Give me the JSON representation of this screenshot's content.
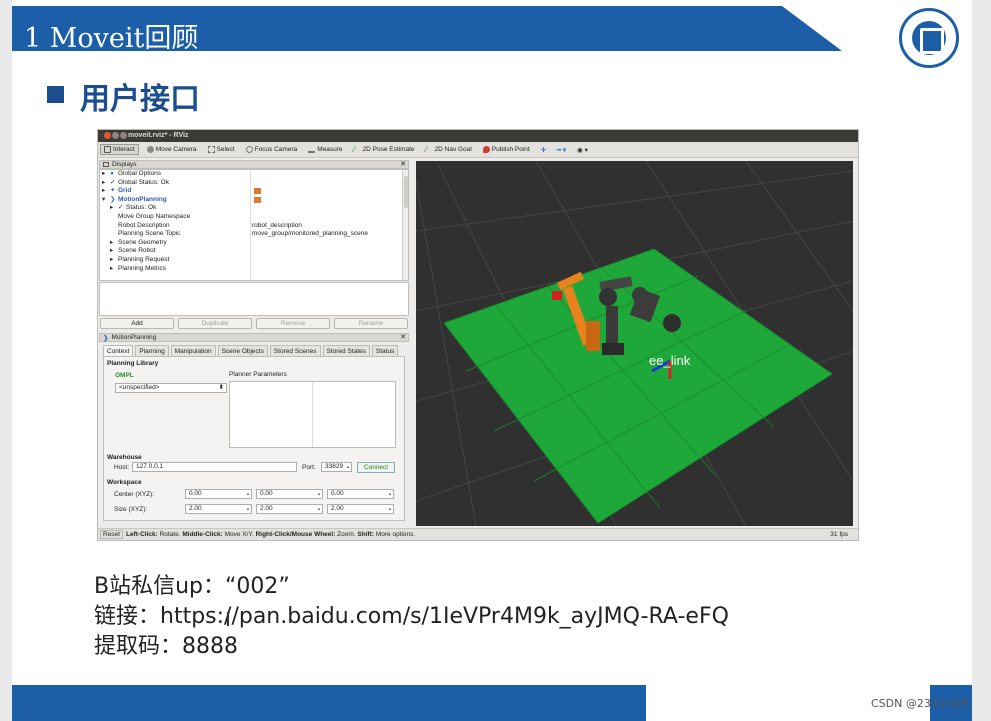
{
  "slide": {
    "title": "1 Moveit回顾",
    "heading": "用户接口",
    "caption_lines": [
      "B站私信up：“002”",
      "链接：https://pan.baidu.com/s/1IeVPr4M9k_ayJMQ-RA-eFQ",
      "提取码：8888"
    ],
    "watermark": "CSDN @2345VOR",
    "colors": {
      "brand_blue": "#1c5fa8",
      "heading_blue": "#1c4e8f"
    }
  },
  "rviz": {
    "window_title": "moveit.rviz* - RViz",
    "toolbar": [
      {
        "label": "Interact",
        "icon": "interact-icon",
        "active": true
      },
      {
        "label": "Move Camera",
        "icon": "move-camera-icon"
      },
      {
        "label": "Select",
        "icon": "select-icon"
      },
      {
        "label": "Focus Camera",
        "icon": "focus-camera-icon"
      },
      {
        "label": "Measure",
        "icon": "measure-icon"
      },
      {
        "label": "2D Pose Estimate",
        "icon": "pose-estimate-icon"
      },
      {
        "label": "2D Nav Goal",
        "icon": "nav-goal-icon"
      },
      {
        "label": "Publish Point",
        "icon": "publish-point-icon"
      }
    ],
    "displays": {
      "title": "Displays",
      "rows": [
        {
          "label": "Global Options",
          "value": ""
        },
        {
          "label": "Global Status: Ok",
          "value": ""
        },
        {
          "label": "Grid",
          "value": ""
        },
        {
          "label": "MotionPlanning",
          "value": ""
        },
        {
          "label": "Status: Ok",
          "value": ""
        },
        {
          "label": "Move Group Namespace",
          "value": ""
        },
        {
          "label": "Robot Description",
          "value": "robot_description"
        },
        {
          "label": "Planning Scene Topic",
          "value": "move_group/monitored_planning_scene"
        },
        {
          "label": "Scene Geometry",
          "value": ""
        },
        {
          "label": "Scene Robot",
          "value": ""
        },
        {
          "label": "Planning Request",
          "value": ""
        },
        {
          "label": "Planning Metrics",
          "value": ""
        }
      ],
      "buttons": {
        "add": "Add",
        "duplicate": "Duplicate",
        "remove": "Remove",
        "rename": "Rename"
      }
    },
    "motion_planning": {
      "title": "MotionPlanning",
      "tabs": [
        "Context",
        "Planning",
        "Manipulation",
        "Scene Objects",
        "Stored Scenes",
        "Stored States",
        "Status"
      ],
      "planning_library_label": "Planning Library",
      "library_name": "OMPL",
      "planner_select": "<unspecified>",
      "planner_params_label": "Planner Parameters",
      "warehouse_label": "Warehouse",
      "host_label": "Host:",
      "host_value": "127.0.0.1",
      "port_label": "Port:",
      "port_value": "33829",
      "connect_label": "Connect",
      "workspace_label": "Workspace",
      "center_label": "Center (XYZ):",
      "center_values": [
        "0.00",
        "0.00",
        "0.00"
      ],
      "size_label": "Size (XYZ):",
      "size_values": [
        "2.00",
        "2.00",
        "2.00"
      ]
    },
    "status_bar": {
      "reset": "Reset",
      "b1": "Left-Click:",
      "t1": " Rotate. ",
      "b2": "Middle-Click:",
      "t2": " Move X/Y. ",
      "b3": "Right-Click/Mouse Wheel:",
      "t3": " Zoom. ",
      "b4": "Shift:",
      "t4": " More options.",
      "fps": "31 fps"
    },
    "viewport": {
      "link_label": "ee_link",
      "ground_color": "#1fa83a",
      "background": "#303030"
    }
  }
}
